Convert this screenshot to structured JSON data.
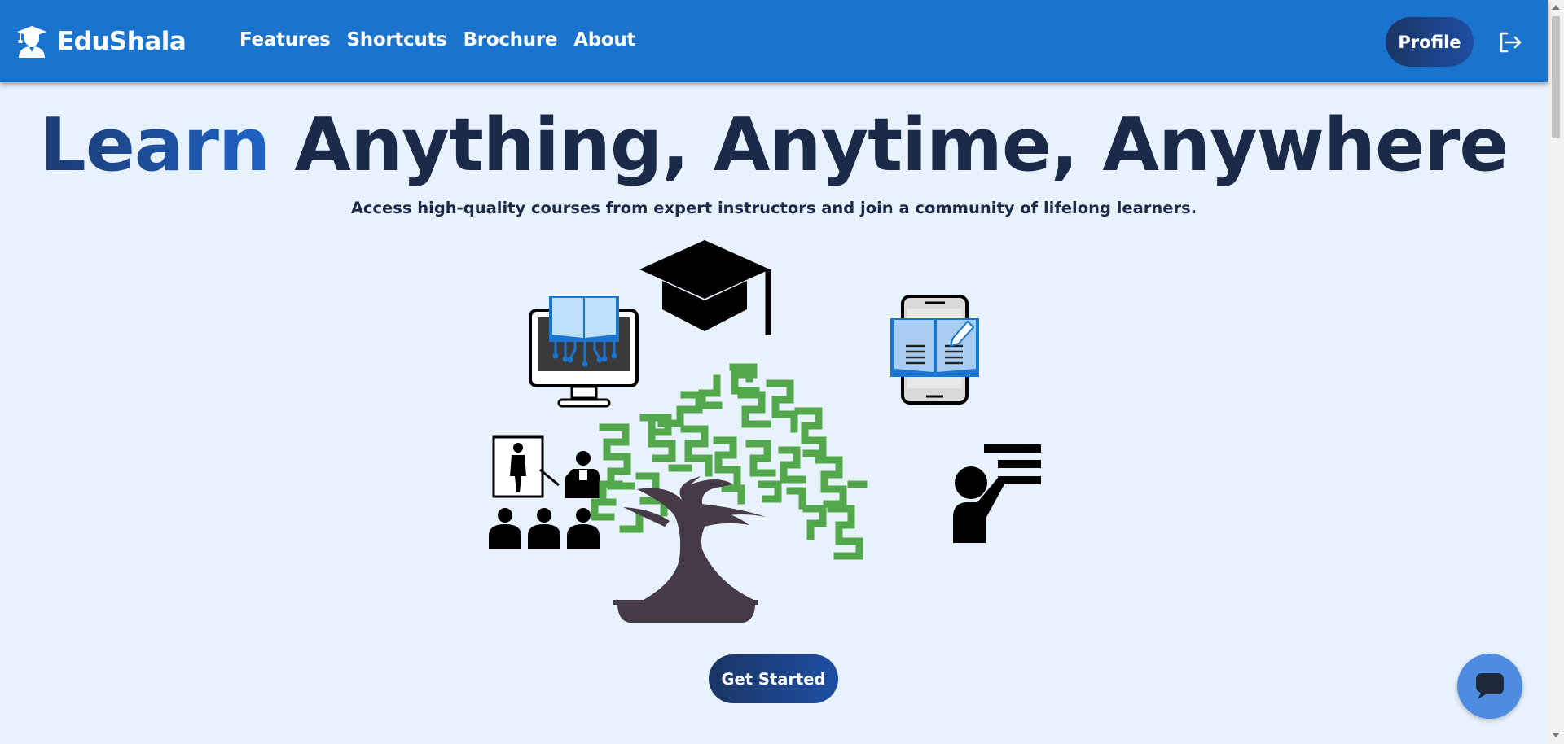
{
  "brand": {
    "name": "EduShala"
  },
  "nav": {
    "links": [
      "Features",
      "Shortcuts",
      "Brochure",
      "About"
    ]
  },
  "header": {
    "profile_label": "Profile"
  },
  "hero": {
    "title_highlight": "Learn",
    "title_rest": " Anything, Anytime, Anywhere",
    "subtitle": "Access high-quality courses from expert instructors and join a community of lifelong learners.",
    "cta_label": "Get Started"
  },
  "colors": {
    "navbar": "#1a73cc",
    "page_background": "#e8f2fc",
    "heading_dark": "#1c2a4a",
    "button_gradient_start": "#1a3563",
    "button_gradient_end": "#1e4ea3",
    "chat_button": "#4d8ce0",
    "tree_leaves": "#52a84a",
    "tree_trunk": "#463a46"
  },
  "icons": {
    "brand": "student-graduate-icon",
    "logout": "logout-icon",
    "chat": "chat-bubble-icon",
    "illustration": [
      "online-book-monitor-icon",
      "graduation-cap-icon",
      "mobile-ebook-icon",
      "teacher-classroom-icon",
      "bonsai-tree-icon",
      "lecturer-board-icon"
    ]
  }
}
